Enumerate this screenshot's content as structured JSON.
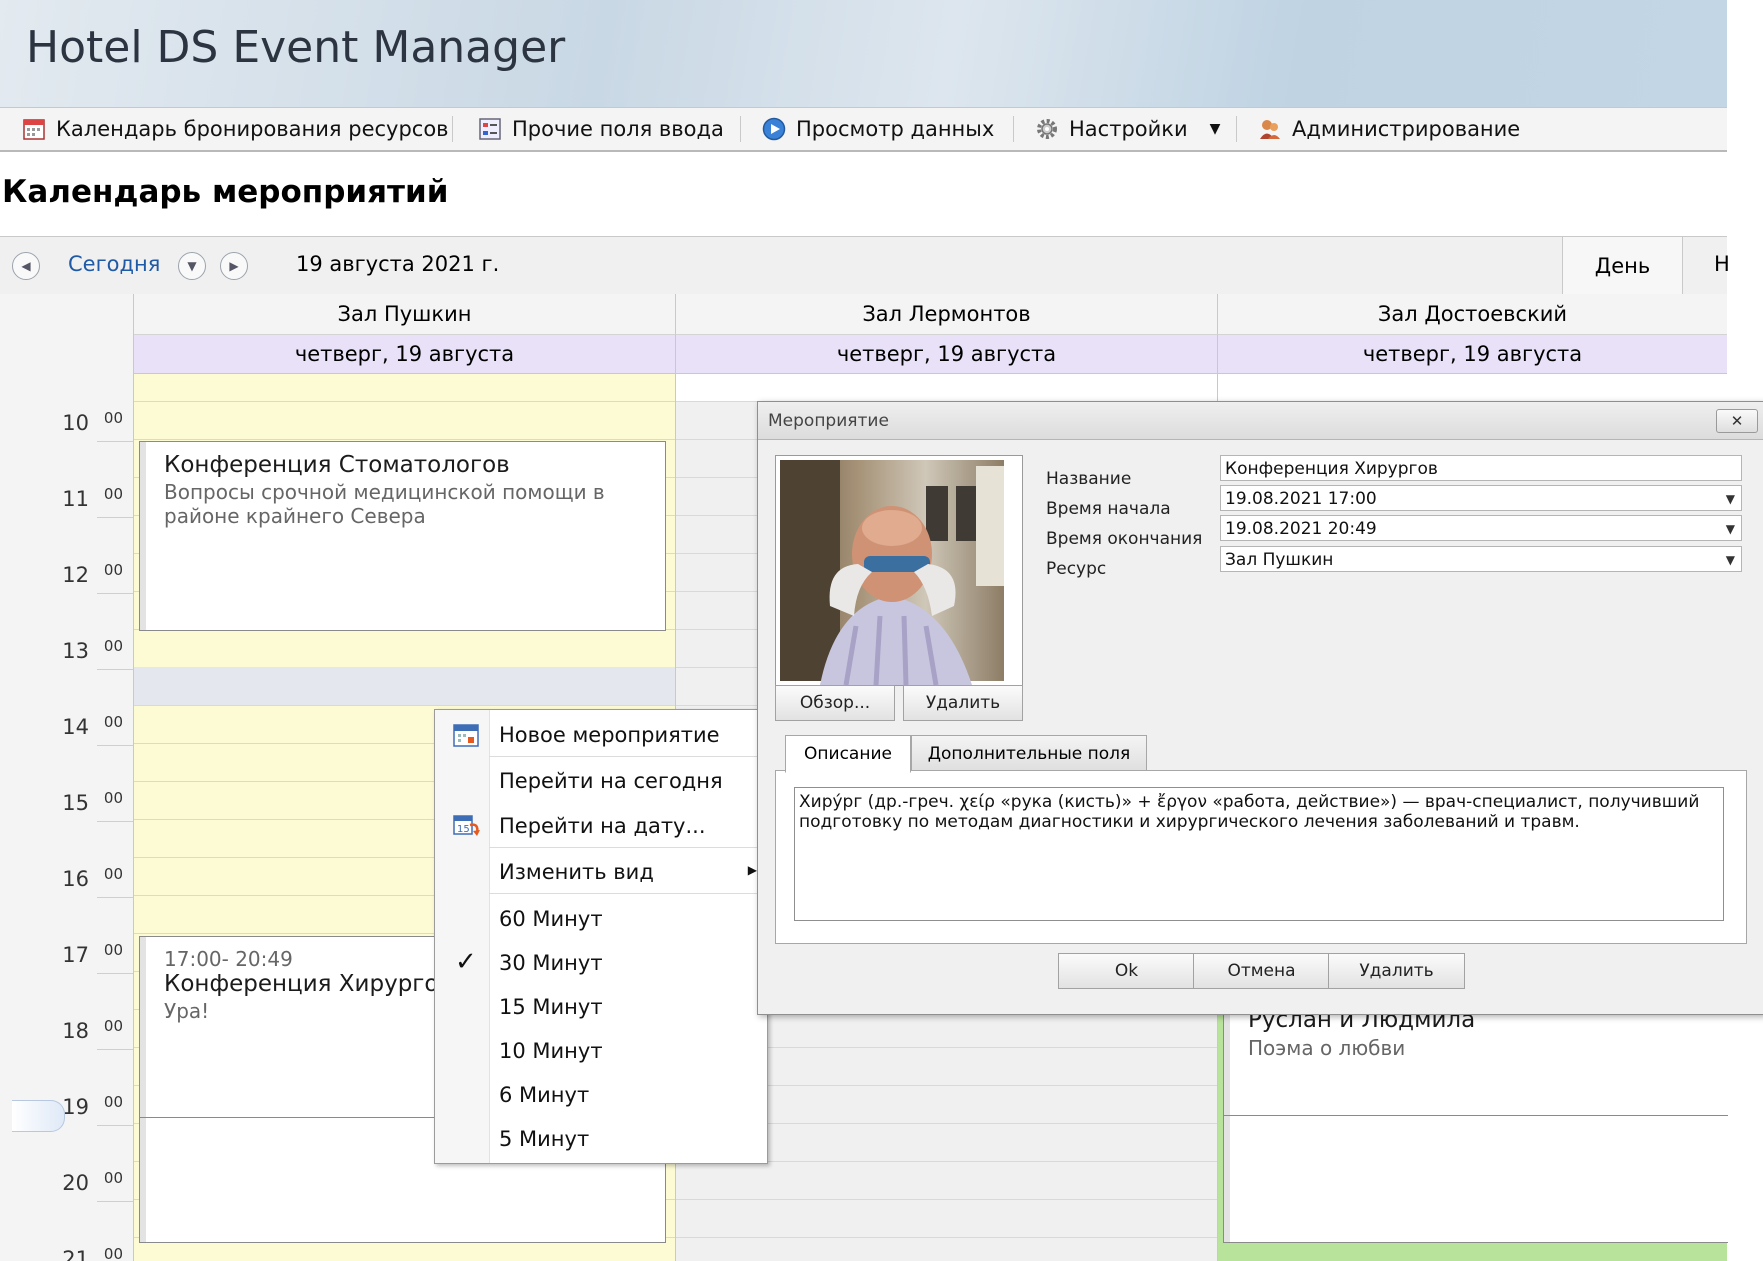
{
  "app": {
    "title": "Hotel DS Event Manager"
  },
  "menu": {
    "items": [
      {
        "label": "Календарь бронирования ресурсов",
        "icon": "calendar-icon"
      },
      {
        "label": "Прочие поля ввода",
        "icon": "form-fields-icon"
      },
      {
        "label": "Просмотр данных",
        "icon": "play-icon"
      },
      {
        "label": "Настройки",
        "icon": "gear-icon"
      },
      {
        "label": "Администрирование",
        "icon": "users-icon"
      }
    ]
  },
  "page": {
    "title": "Календарь мероприятий"
  },
  "toolbar": {
    "today_label": "Сегодня",
    "date_label": "19 августа 2021 г.",
    "view_day": "День",
    "view_next": "Н"
  },
  "resources": [
    {
      "name": "Зал Пушкин",
      "date": "четверг, 19 августа",
      "color": "#fdfbd3"
    },
    {
      "name": "Зал Лермонтов",
      "date": "четверг, 19 августа",
      "color": "#ffffff"
    },
    {
      "name": "Зал Достоевский",
      "date": "четверг, 19 августа",
      "color": "#b8e39b"
    }
  ],
  "hours": [
    {
      "h": "10",
      "m": "00"
    },
    {
      "h": "11",
      "m": "00"
    },
    {
      "h": "12",
      "m": "00"
    },
    {
      "h": "13",
      "m": "00"
    },
    {
      "h": "14",
      "m": "00"
    },
    {
      "h": "15",
      "m": "00"
    },
    {
      "h": "16",
      "m": "00"
    },
    {
      "h": "17",
      "m": "00"
    },
    {
      "h": "18",
      "m": "00"
    },
    {
      "h": "19",
      "m": "00"
    },
    {
      "h": "20",
      "m": "00"
    },
    {
      "h": "21",
      "m": "00"
    }
  ],
  "appointments": {
    "a1": {
      "title": "Конференция Стоматологов",
      "desc_line1": "Вопросы срочной медицинской помощи в",
      "desc_line2": "районе крайнего Севера"
    },
    "a2": {
      "time": "17:00- 20:49",
      "title": "Конференция Хирургов",
      "desc": "Ура!"
    },
    "a3": {
      "title": "Руслан и Людмила",
      "desc": "Поэма о любви"
    }
  },
  "context_menu": {
    "new_event": "Новое мероприятие",
    "go_today": "Перейти на сегодня",
    "go_date": "Перейти на дату...",
    "change_view": "Изменить вид",
    "intervals": [
      "60 Минут",
      "30 Минут",
      "15 Минут",
      "10 Минут",
      "6 Минут",
      "5 Минут"
    ],
    "checked": "30 Минут"
  },
  "dialog": {
    "title": "Мероприятие",
    "close_label": "✕",
    "browse_label": "Обзор...",
    "delete_photo_label": "Удалить",
    "fields": {
      "name_label": "Название",
      "name_value": "Конференция Хирургов",
      "start_label": "Время начала",
      "start_value": "19.08.2021 17:00",
      "end_label": "Время окончания",
      "end_value": "19.08.2021 20:49",
      "resource_label": "Ресурс",
      "resource_value": "Зал Пушкин"
    },
    "tabs": {
      "description": "Описание",
      "extra": "Дополнительные поля"
    },
    "description_text": "Хиру́рг (др.-греч. χείρ «рука (кисть)» + ἔργον «работа, действие») — врач-специалист, получивший подготовку по методам диагностики и хирургического лечения заболеваний и травм.",
    "ok_label": "Ok",
    "cancel_label": "Отмена",
    "delete_label": "Удалить"
  }
}
